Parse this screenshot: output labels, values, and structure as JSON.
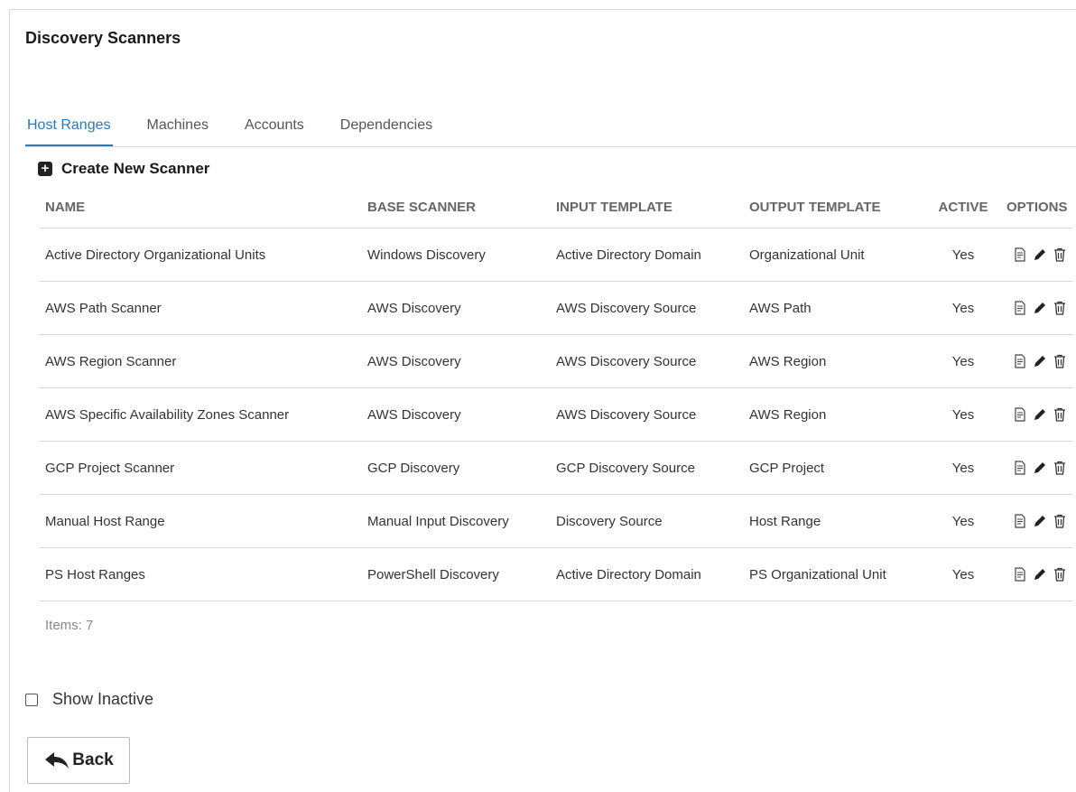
{
  "page": {
    "title": "Discovery Scanners"
  },
  "tabs": [
    {
      "label": "Host Ranges",
      "active": true
    },
    {
      "label": "Machines"
    },
    {
      "label": "Accounts"
    },
    {
      "label": "Dependencies"
    }
  ],
  "create_label": "Create New Scanner",
  "table": {
    "headers": [
      "NAME",
      "BASE SCANNER",
      "INPUT TEMPLATE",
      "OUTPUT TEMPLATE",
      "ACTIVE",
      "OPTIONS"
    ],
    "rows": [
      [
        "Active Directory Organizational Units",
        "Windows Discovery",
        "Active Directory Domain",
        "Organizational Unit",
        "Yes"
      ],
      [
        "AWS Path Scanner",
        "AWS Discovery",
        "AWS Discovery Source",
        "AWS Path",
        "Yes"
      ],
      [
        "AWS Region Scanner",
        "AWS Discovery",
        "AWS Discovery Source",
        "AWS Region",
        "Yes"
      ],
      [
        "AWS Specific Availability Zones Scanner",
        "AWS Discovery",
        "AWS Discovery Source",
        "AWS Region",
        "Yes"
      ],
      [
        "GCP Project Scanner",
        "GCP Discovery",
        "GCP Discovery Source",
        "GCP Project",
        "Yes"
      ],
      [
        "Manual Host Range",
        "Manual Input Discovery",
        "Discovery Source",
        "Host Range",
        "Yes"
      ],
      [
        "PS Host Ranges",
        "PowerShell Discovery",
        "Active Directory Domain",
        "PS Organizational Unit",
        "Yes"
      ]
    ],
    "option_icons": [
      "view-doc-icon",
      "edit-pencil-icon",
      "trash-icon"
    ]
  },
  "items_label": "Items: 7",
  "show_inactive_label": "Show Inactive",
  "back_label": "Back",
  "colors": {
    "accent": "#2a7ab9",
    "border": "#d9d9d9"
  }
}
